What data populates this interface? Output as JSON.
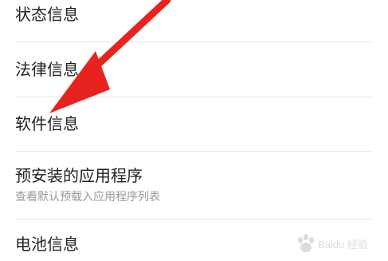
{
  "settings": {
    "items": [
      {
        "title": "状态信息"
      },
      {
        "title": "法律信息"
      },
      {
        "title": "软件信息"
      },
      {
        "title": "预安装的应用程序",
        "subtitle": "查看默认预载入应用程序列表"
      },
      {
        "title": "电池信息"
      }
    ]
  },
  "annotation": {
    "arrow_color": "#e8231f",
    "arrow_target": "软件信息"
  },
  "watermark": {
    "brand": "Baidu 经验"
  }
}
